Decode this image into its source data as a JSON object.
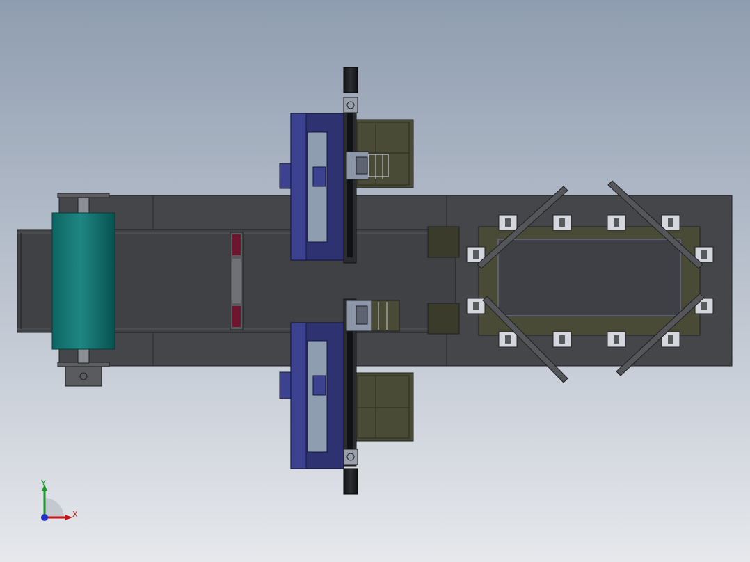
{
  "viewport": {
    "background_top": "#8f9db0",
    "background_bottom": "#e6e8ec"
  },
  "colors": {
    "frame_dark": "#454649",
    "frame_mid": "#58595c",
    "belt": "#404145",
    "roller_teal": "#0d6663",
    "roller_teal_light": "#1f8682",
    "gantry_blue": "#2e3270",
    "gantry_blue_light": "#3c4190",
    "olive": "#4a4b36",
    "olive_dark": "#3a3b2b",
    "motor_black": "#1b1c1e",
    "light_blue_gray": "#8c96a8",
    "clamp_white": "#d4d7dd",
    "crimson": "#6e1530",
    "edge": "#1e1f22"
  },
  "triad": {
    "x_label": "X",
    "y_label": "Y",
    "x_color": "#c41818",
    "y_color": "#1a9a28",
    "z_color": "#2430c4",
    "icon": "coordinate-triad-icon"
  }
}
